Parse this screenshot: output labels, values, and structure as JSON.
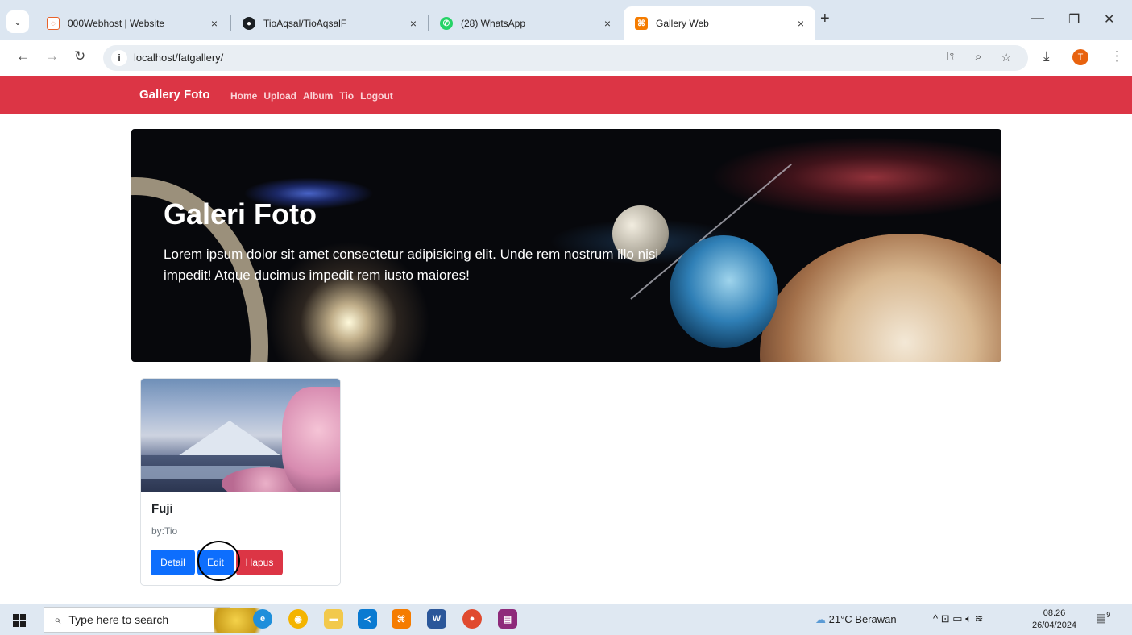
{
  "browser": {
    "tabs": [
      {
        "title": "000Webhost | Website",
        "favicon": "webhost-icon",
        "color": "#e8622b"
      },
      {
        "title": "TioAqsal/TioAqsalF",
        "favicon": "github-icon",
        "color": "#1b1f23"
      },
      {
        "title": "(28) WhatsApp",
        "favicon": "whatsapp-icon",
        "color": "#25d366"
      },
      {
        "title": "Gallery Web",
        "favicon": "xampp-icon",
        "color": "#f57c00"
      }
    ],
    "close_glyph": "×",
    "new_tab_glyph": "+",
    "url": "localhost/fatgallery/",
    "profile_initial": "T"
  },
  "navbar": {
    "brand": "Gallery Foto",
    "links": [
      "Home",
      "Upload",
      "Album",
      "Tio",
      "Logout"
    ],
    "color": "#dc3545"
  },
  "hero": {
    "title": "Galeri Foto",
    "text": "Lorem ipsum dolor sit amet consectetur adipisicing elit. Unde rem nostrum illo nisi impedit! Atque ducimus impedit rem iusto maiores!"
  },
  "photos": [
    {
      "title": "Fuji",
      "author": "by:Tio",
      "buttons": {
        "detail": "Detail",
        "edit": "Edit",
        "delete": "Hapus"
      }
    }
  ],
  "taskbar": {
    "search_placeholder": "Type here to search",
    "weather": "21°C  Berawan",
    "time": "08.26",
    "date": "26/04/2024",
    "notification_count": "9"
  }
}
